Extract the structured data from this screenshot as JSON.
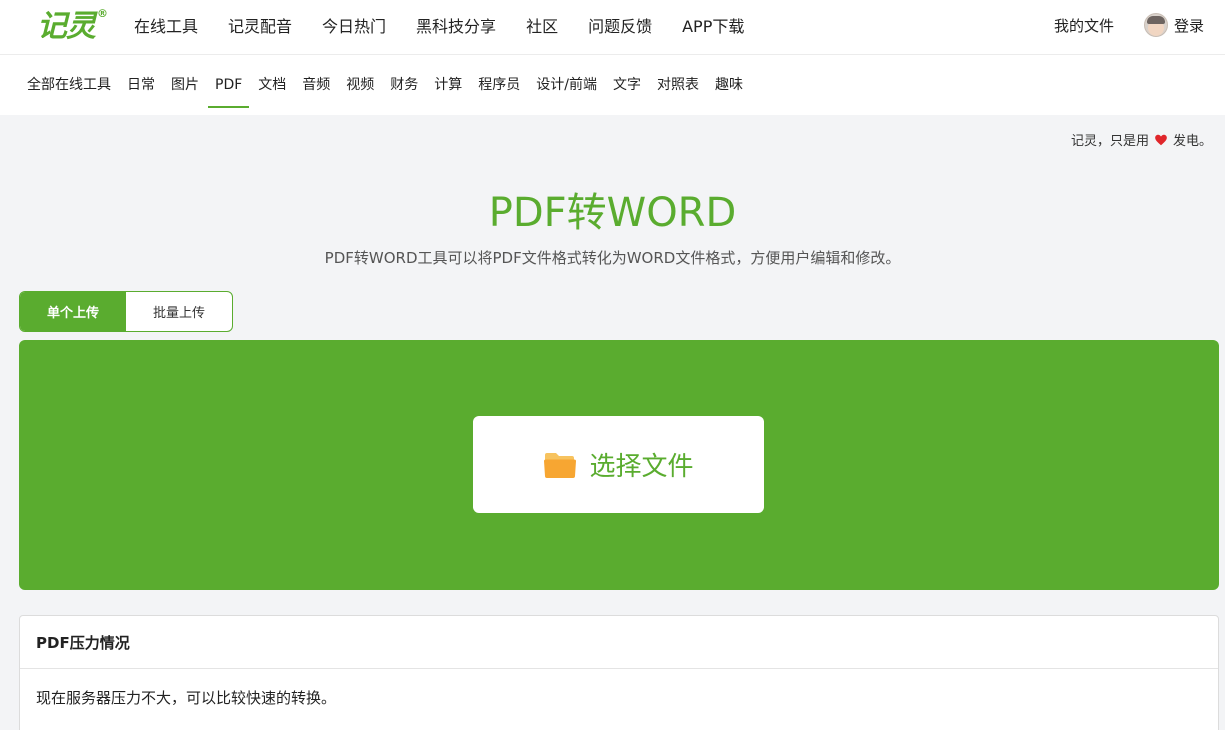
{
  "header": {
    "logo_text": "记灵",
    "logo_mark": "®",
    "nav": [
      "在线工具",
      "记灵配音",
      "今日热门",
      "黑科技分享",
      "社区",
      "问题反馈",
      "APP下载"
    ],
    "my_files": "我的文件",
    "login": "登录"
  },
  "subnav": {
    "items": [
      "全部在线工具",
      "日常",
      "图片",
      "PDF",
      "文档",
      "音频",
      "视频",
      "财务",
      "计算",
      "程序员",
      "设计/前端",
      "文字",
      "对照表",
      "趣味"
    ],
    "active": "PDF"
  },
  "slogan": {
    "before": "记灵，只是用",
    "after": "发电。"
  },
  "page": {
    "title": "PDF转WORD",
    "description": "PDF转WORD工具可以将PDF文件格式转化为WORD文件格式，方便用户编辑和修改。"
  },
  "upload": {
    "tabs": [
      "单个上传",
      "批量上传"
    ],
    "active_tab": "单个上传",
    "select_label": "选择文件"
  },
  "status_panel": {
    "title": "PDF压力情况",
    "text": "现在服务器压力不大，可以比较快速的转换。"
  },
  "colors": {
    "accent": "#5aac2f",
    "heart": "#e0262b",
    "folder": "#f7a632"
  },
  "icons": {
    "logo": "jiling-logo",
    "avatar": "user-avatar",
    "heart": "heart-icon",
    "folder": "folder-icon"
  }
}
